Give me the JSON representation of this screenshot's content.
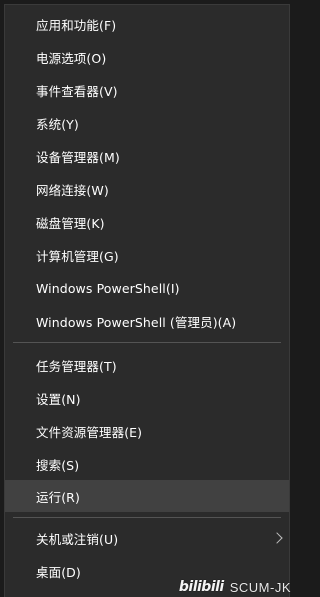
{
  "menu": {
    "group1": [
      {
        "label": "应用和功能(F)"
      },
      {
        "label": "电源选项(O)"
      },
      {
        "label": "事件查看器(V)"
      },
      {
        "label": "系统(Y)"
      },
      {
        "label": "设备管理器(M)"
      },
      {
        "label": "网络连接(W)"
      },
      {
        "label": "磁盘管理(K)"
      },
      {
        "label": "计算机管理(G)"
      },
      {
        "label": "Windows PowerShell(I)"
      },
      {
        "label": "Windows PowerShell (管理员)(A)"
      }
    ],
    "group2": [
      {
        "label": "任务管理器(T)"
      },
      {
        "label": "设置(N)"
      },
      {
        "label": "文件资源管理器(E)"
      },
      {
        "label": "搜索(S)"
      },
      {
        "label": "运行(R)",
        "highlighted": true
      }
    ],
    "group3": [
      {
        "label": "关机或注销(U)",
        "has_submenu": true,
        "submenu_icon": "chevron-right-icon"
      },
      {
        "label": "桌面(D)"
      }
    ]
  },
  "watermark": {
    "logo_text": "bilibili",
    "user_text": "SCUM-JK"
  },
  "colors": {
    "menu_background": "#2b2b2b",
    "highlight_background": "#414141",
    "text": "#ffffff",
    "divider": "#545454"
  }
}
